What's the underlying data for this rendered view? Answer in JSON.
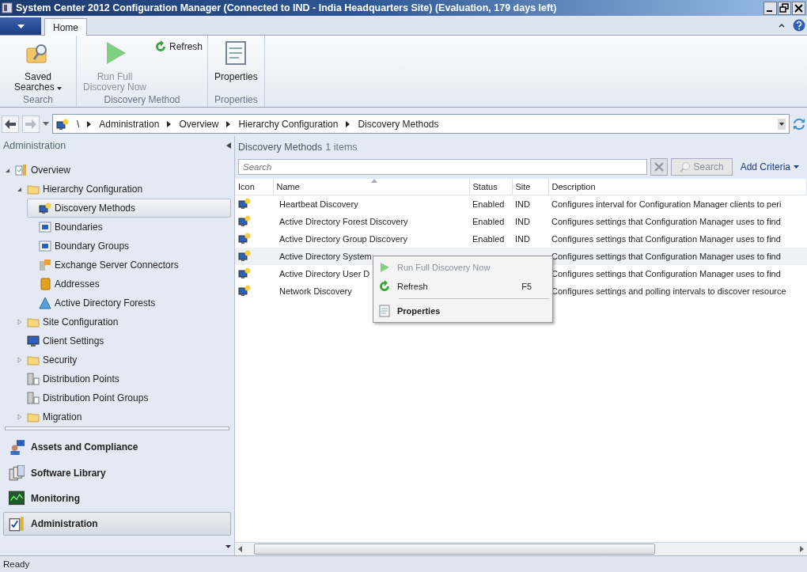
{
  "window": {
    "title": "System Center 2012 Configuration Manager (Connected to IND - India Headquarters Site) (Evaluation, 179 days left)"
  },
  "ribbon": {
    "tabs": [
      {
        "label": "Home",
        "selected": true
      }
    ],
    "groups": [
      {
        "label": "Search",
        "commands": [
          {
            "kind": "search-folder",
            "label": "Saved Searches",
            "dropdown": true,
            "disabled": false
          }
        ]
      },
      {
        "label": "Discovery Method",
        "commands": [
          {
            "kind": "play",
            "label": "Run Full Discovery Now",
            "disabled": true
          },
          {
            "kind": "refresh",
            "label": "Refresh",
            "disabled": false
          }
        ]
      },
      {
        "label": "Properties",
        "commands": [
          {
            "kind": "properties",
            "label": "Properties",
            "disabled": false
          }
        ]
      }
    ]
  },
  "address_bar": {
    "root": "\\",
    "path": [
      "Administration",
      "Overview",
      "Hierarchy Configuration",
      "Discovery Methods"
    ]
  },
  "navigation": {
    "title": "Administration",
    "tree": [
      {
        "label": "Overview",
        "kind": "overview",
        "expanded": true,
        "selected": false,
        "children": [
          {
            "label": "Hierarchy Configuration",
            "kind": "folder",
            "expanded": true,
            "selected": false,
            "children": [
              {
                "label": "Discovery Methods",
                "kind": "discovery",
                "selected": true
              },
              {
                "label": "Boundaries",
                "kind": "boundary",
                "selected": false
              },
              {
                "label": "Boundary Groups",
                "kind": "boundary",
                "selected": false
              },
              {
                "label": "Exchange Server Connectors",
                "kind": "exchange",
                "selected": false
              },
              {
                "label": "Addresses",
                "kind": "book",
                "selected": false
              },
              {
                "label": "Active Directory Forests",
                "kind": "forest",
                "selected": false
              }
            ]
          },
          {
            "label": "Site Configuration",
            "kind": "folder",
            "expanded": false,
            "selected": false
          },
          {
            "label": "Client Settings",
            "kind": "computer",
            "selected": false
          },
          {
            "label": "Security",
            "kind": "folder",
            "expanded": false,
            "selected": false
          },
          {
            "label": "Distribution Points",
            "kind": "server",
            "selected": false
          },
          {
            "label": "Distribution Point Groups",
            "kind": "server",
            "selected": false
          },
          {
            "label": "Migration",
            "kind": "folder",
            "expanded": false,
            "selected": false
          }
        ]
      }
    ],
    "workspaces": [
      {
        "label": "Assets and Compliance",
        "kind": "user-computer",
        "selected": false
      },
      {
        "label": "Software Library",
        "kind": "library",
        "selected": false
      },
      {
        "label": "Monitoring",
        "kind": "monitor",
        "selected": false
      },
      {
        "label": "Administration",
        "kind": "admin",
        "selected": true
      }
    ]
  },
  "list": {
    "title": "Discovery Methods",
    "count": "1 items",
    "search": {
      "placeholder": "Search",
      "button": "Search",
      "disabled": true
    },
    "add_criteria": "Add Criteria",
    "columns": [
      "Icon",
      "Name",
      "Status",
      "Site",
      "Description"
    ],
    "rows": [
      {
        "name": "Heartbeat Discovery",
        "status": "Enabled",
        "site": "IND",
        "description": "Configures interval for Configuration Manager clients to peri",
        "selected": false
      },
      {
        "name": "Active Directory Forest Discovery",
        "status": "Enabled",
        "site": "IND",
        "description": "Configures settings that Configuration Manager uses to find",
        "selected": false
      },
      {
        "name": "Active Directory Group Discovery",
        "status": "Enabled",
        "site": "IND",
        "description": "Configures settings that Configuration Manager uses to find",
        "selected": false
      },
      {
        "name": "Active Directory System",
        "description": "Configures settings that Configuration Manager uses to find",
        "selected": true
      },
      {
        "name": "Active Directory User D",
        "description": "Configures settings that Configuration Manager uses to find",
        "selected": false
      },
      {
        "name": "Network Discovery",
        "description": "Configures settings and polling intervals to discover resource",
        "selected": false
      }
    ]
  },
  "context_menu": [
    {
      "kind": "play",
      "label": "Run Full Discovery Now",
      "disabled": true,
      "default": false
    },
    {
      "kind": "refresh",
      "label": "Refresh",
      "shortcut": "F5",
      "disabled": false,
      "default": false
    },
    {
      "kind": "separator"
    },
    {
      "kind": "properties",
      "label": "Properties",
      "disabled": false,
      "default": true
    }
  ],
  "status_bar": "Ready"
}
